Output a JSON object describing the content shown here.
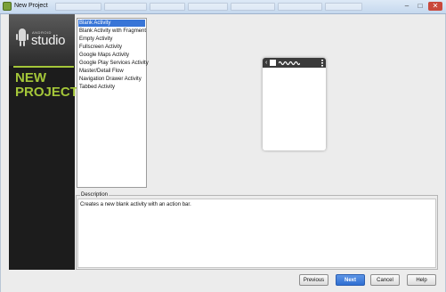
{
  "window": {
    "title": "New Project",
    "controls": {
      "minimize": "–",
      "maximize": "□",
      "close": "✕"
    }
  },
  "branding": {
    "small_label": "ANDROID",
    "studio_label": "studio",
    "title_line1": "NEW",
    "title_line2": "PROJECT",
    "accent_color": "#a4c639"
  },
  "activities": {
    "items": [
      "Blank Activity",
      "Blank Activity with Fragment",
      "Empty Activity",
      "Fullscreen Activity",
      "Google Maps Activity",
      "Google Play Services Activity",
      "Master/Detail Flow",
      "Navigation Drawer Activity",
      "Tabbed Activity"
    ],
    "selected": "Blank Activity"
  },
  "preview": {
    "chevron": "‹",
    "menu_icon": "overflow-menu-icon"
  },
  "description": {
    "legend": "Description",
    "text": "Creates a new blank activity with an action bar."
  },
  "buttons": {
    "previous": "Previous",
    "next": "Next",
    "cancel": "Cancel",
    "help": "Help"
  }
}
